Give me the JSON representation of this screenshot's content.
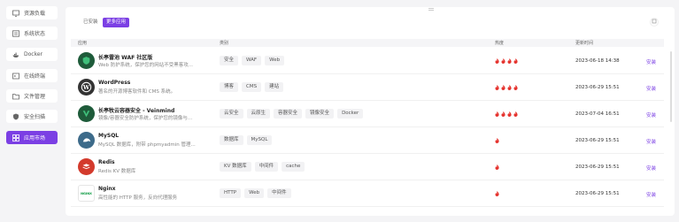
{
  "sidebar": {
    "items": [
      {
        "label": "资源负载",
        "icon": "monitor-icon",
        "active": false
      },
      {
        "label": "系统状态",
        "icon": "list-icon",
        "active": false
      },
      {
        "label": "Docker",
        "icon": "docker-icon",
        "active": false
      },
      {
        "label": "在线终端",
        "icon": "terminal-icon",
        "active": false
      },
      {
        "label": "文件管理",
        "icon": "folder-icon",
        "active": false
      },
      {
        "label": "安全扫描",
        "icon": "shield-icon",
        "active": false
      },
      {
        "label": "应用市场",
        "icon": "apps-icon",
        "active": true
      }
    ]
  },
  "tabs": {
    "installed": "已安装",
    "more": "更多应用"
  },
  "table": {
    "headers": {
      "app": "应用",
      "category": "类别",
      "heat": "热度",
      "updated": "更新时间"
    },
    "rows": [
      {
        "name": "长亭雷池 WAF 社区版",
        "desc": "Web 防护系统，保护您的网站不受黑客攻...",
        "tags": [
          "安全",
          "WAF",
          "Web"
        ],
        "heat": 4,
        "time": "2023-06-18 14:38",
        "action": "安装",
        "logo": "safeline-logo-icon",
        "logo_color": "#1e5b3a"
      },
      {
        "name": "WordPress",
        "desc": "著名的开源博客软件和 CMS 系统。",
        "tags": [
          "博客",
          "CMS",
          "建站"
        ],
        "heat": 4,
        "time": "2023-06-29 15:51",
        "action": "安装",
        "logo": "wordpress-logo-icon",
        "logo_color": "#333333"
      },
      {
        "name": "长亭牧云容器安全 - Veinmind",
        "desc": "镜像/容器安全防护系统，保护您的镜像与...",
        "tags": [
          "云安全",
          "云原生",
          "容器安全",
          "镜像安全",
          "Docker"
        ],
        "heat": 4,
        "time": "2023-07-04 16:51",
        "action": "安装",
        "logo": "veinmind-logo-icon",
        "logo_color": "#1e5b3a"
      },
      {
        "name": "MySQL",
        "desc": "MySQL 数据库，附带 phpmyadmin 管理...",
        "tags": [
          "数据库",
          "MySQL"
        ],
        "heat": 1,
        "time": "2023-06-29 15:51",
        "action": "安装",
        "logo": "mysql-logo-icon",
        "logo_color": "#3d6b8a"
      },
      {
        "name": "Redis",
        "desc": "Redis KV 数据库",
        "tags": [
          "KV 数据库",
          "中间件",
          "cache"
        ],
        "heat": 1,
        "time": "2023-06-29 15:51",
        "action": "安装",
        "logo": "redis-logo-icon",
        "logo_color": "#d33a2c"
      },
      {
        "name": "Nginx",
        "desc": "高性能的 HTTP 服务，反向代理服务",
        "tags": [
          "HTTP",
          "Web",
          "中间件"
        ],
        "heat": 1,
        "time": "2023-06-29 15:51",
        "action": "安装",
        "logo": "nginx-logo-icon",
        "logo_color": "#ffffff"
      }
    ]
  },
  "colors": {
    "accent": "#7b3fe4",
    "heat": "#e5322d"
  }
}
